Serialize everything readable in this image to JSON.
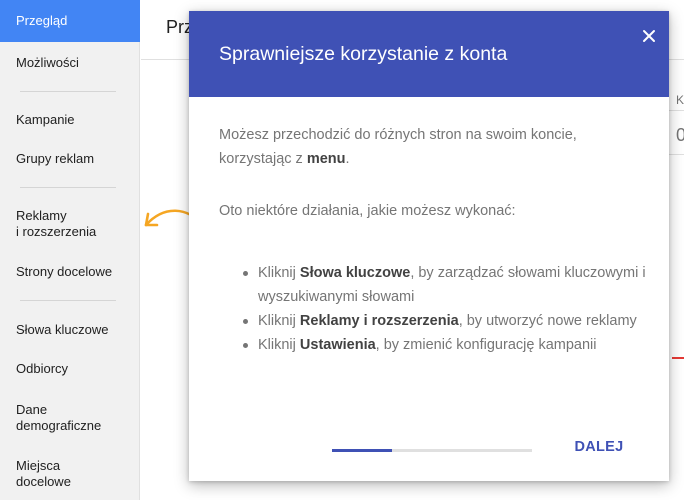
{
  "sidebar": {
    "items": [
      {
        "label": "Przegląd"
      },
      {
        "label": "Możliwości"
      },
      {
        "label": "Kampanie"
      },
      {
        "label": "Grupy reklam"
      },
      {
        "label": "Reklamy\ni rozszerzenia"
      },
      {
        "label": "Strony docelowe"
      },
      {
        "label": "Słowa kluczowe"
      },
      {
        "label": "Odbiorcy"
      },
      {
        "label": "Dane\ndemograficzne"
      },
      {
        "label": "Miejsca\ndocelowe"
      }
    ]
  },
  "main": {
    "title": "Prz",
    "peek_k": "K",
    "peek_zero": "0"
  },
  "dialog": {
    "title": "Sprawniejsze korzystanie z konta",
    "intro_before": "Możesz przechodzić do różnych stron na swoim koncie, korzystając z ",
    "intro_bold": "menu",
    "intro_after": ".",
    "subheading": "Oto niektóre działania, jakie możesz wykonać:",
    "bullets": [
      {
        "prefix": "Kliknij ",
        "bold": "Słowa kluczowe",
        "suffix": ", by zarządzać słowami kluczowymi i wyszukiwanymi słowami"
      },
      {
        "prefix": "Kliknij ",
        "bold": "Reklamy i rozszerzenia",
        "suffix": ", by utworzyć nowe reklamy"
      },
      {
        "prefix": "Kliknij ",
        "bold": "Ustawienia",
        "suffix": ", by zmienić konfigurację kampanii"
      }
    ],
    "next_label": "DALEJ",
    "progress_fraction": 0.3
  },
  "colors": {
    "accent": "#3f51b5",
    "sidebar_active": "#4285f4",
    "arrow": "#f5a623"
  },
  "icons": {
    "close": "close-icon",
    "arrow": "curved-arrow-icon"
  }
}
